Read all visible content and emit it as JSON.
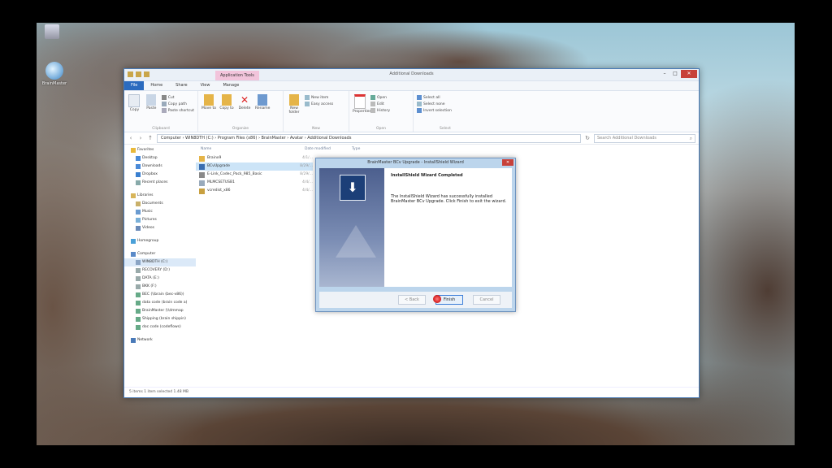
{
  "desktop": {
    "icon_label": "BrainMaster"
  },
  "window": {
    "title": "Additional Downloads",
    "app_tools_label": "Application Tools",
    "tabs": [
      "File",
      "Home",
      "Share",
      "View",
      "Manage"
    ],
    "ribbon": {
      "clipboard_group": "Clipboard",
      "organize_group": "Organize",
      "new_group": "New",
      "open_group": "Open",
      "select_group": "Select",
      "copy": "Copy",
      "paste": "Paste",
      "cut": "Cut",
      "copy_path": "Copy path",
      "paste_shortcut": "Paste shortcut",
      "move_to": "Move to",
      "copy_to": "Copy to",
      "delete": "Delete",
      "rename": "Rename",
      "new_folder": "New folder",
      "new_item": "New item",
      "easy_access": "Easy access",
      "properties": "Properties",
      "open": "Open",
      "edit": "Edit",
      "history": "History",
      "select_all": "Select all",
      "select_none": "Select none",
      "invert_selection": "Invert selection"
    },
    "address": "Computer › WIN8DTH (C:) › Program Files (x86) › BrainMaster › Avatar › Additional Downloads",
    "search_placeholder": "Search Additional Downloads",
    "nav": {
      "favorites": "Favorites",
      "desktop": "Desktop",
      "downloads": "Downloads",
      "dropbox": "Dropbox",
      "recent": "Recent places",
      "libraries": "Libraries",
      "documents": "Documents",
      "music": "Music",
      "pictures": "Pictures",
      "videos": "Videos",
      "homegroup": "Homegroup",
      "computer": "Computer",
      "drive_c": "WIN8DTH (C:)",
      "drive_d": "RECOVERY (D:)",
      "drive_e": "DATA (E:)",
      "drive_f": "BKK (F:)",
      "net1": "BEC (\\\\brain (bec-v86))",
      "net2": "data code (brain code a)",
      "net3": "BrainMaster (\\\\dmmap",
      "net4": "Shipping (brain shippin)",
      "net5": "doc code (codeflows)",
      "network": "Network"
    },
    "columns": [
      "Name",
      "Date modified",
      "Type"
    ],
    "files": [
      {
        "name": "Brainx9",
        "date": "4/1/..."
      },
      {
        "name": "BCvUpgrade",
        "date": "8/29/..."
      },
      {
        "name": "E-Link_Codec_Pack_985_Basic",
        "date": "8/29/..."
      },
      {
        "name": "MLMCSETUSB1",
        "date": "4/4/..."
      },
      {
        "name": "vcredist_x86",
        "date": "4/4/..."
      }
    ],
    "status": "5 items    1 item selected  1.48 MB"
  },
  "dialog": {
    "title": "BrainMaster BCv Upgrade - InstallShield Wizard",
    "heading": "InstallShield Wizard Completed",
    "message": "The InstallShield Wizard has successfully installed BrainMaster BCv Upgrade. Click Finish to exit the wizard.",
    "back": "< Back",
    "finish": "Finish",
    "cancel": "Cancel"
  }
}
